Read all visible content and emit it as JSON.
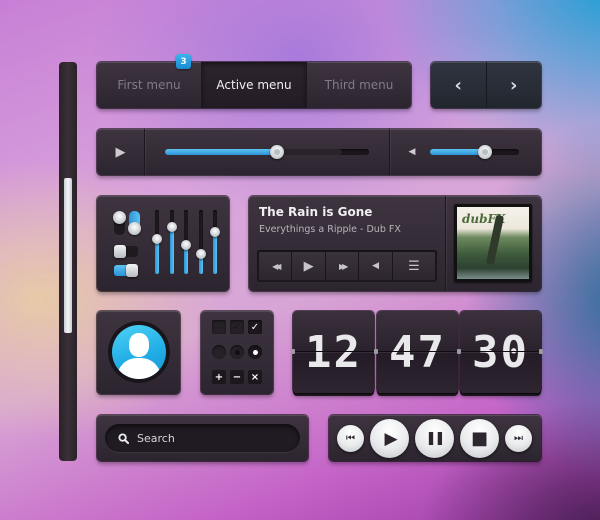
{
  "colors": {
    "accent": "#2a94d6",
    "panel": "#342b36",
    "badge": "#1a8bd1"
  },
  "scrollbar": {
    "thumb_start_fraction": 0.29,
    "thumb_end_fraction": 0.68
  },
  "menu": {
    "items": [
      {
        "label": "First menu",
        "badge": "3",
        "active": false
      },
      {
        "label": "Active menu",
        "active": true
      },
      {
        "label": "Third menu",
        "active": false
      }
    ]
  },
  "nav_arrows": {
    "prev_icon": "chevron-left-icon",
    "prev_glyph": "‹",
    "next_icon": "chevron-right-icon",
    "next_glyph": "›"
  },
  "progress_bar": {
    "play_glyph": "▶",
    "progress_fraction": 0.55,
    "buffered_fraction": 0.87,
    "volume_glyph": "◀",
    "volume_fraction": 0.62
  },
  "equalizer": {
    "vertical_toggle": {
      "left_on": false,
      "right_on": true
    },
    "horizontal_toggles": [
      {
        "on": false
      },
      {
        "on": true
      }
    ],
    "sliders": [
      0.55,
      0.74,
      0.45,
      0.32,
      0.65
    ]
  },
  "player": {
    "title": "The Rain is Gone",
    "subtitle": "Everythings a Ripple - Dub FX",
    "controls": [
      {
        "name": "rewind",
        "glyph": "◀◀"
      },
      {
        "name": "play",
        "glyph": "▶"
      },
      {
        "name": "fast-forward",
        "glyph": "▶▶"
      },
      {
        "name": "volume",
        "glyph": "◀"
      },
      {
        "name": "playlist",
        "glyph": "☰"
      }
    ],
    "album_logo": "dubFX"
  },
  "form_controls": {
    "checkboxes": [
      {
        "state": "unchecked"
      },
      {
        "state": "checked-dim",
        "glyph": "✓"
      },
      {
        "state": "checked",
        "glyph": "✓"
      }
    ],
    "radios": [
      {
        "state": "unselected"
      },
      {
        "state": "selected-dim"
      },
      {
        "state": "selected"
      }
    ],
    "actions": [
      {
        "name": "add",
        "glyph": "+"
      },
      {
        "name": "remove",
        "glyph": "−"
      },
      {
        "name": "close",
        "glyph": "×"
      }
    ]
  },
  "clock": {
    "hours": "12",
    "minutes": "47",
    "seconds": "30"
  },
  "search": {
    "placeholder": "Search",
    "value": ""
  },
  "transport": {
    "buttons": [
      {
        "name": "skip-back",
        "glyph": "⏮"
      },
      {
        "name": "play",
        "glyph": "▶"
      },
      {
        "name": "pause",
        "glyph": "❚❚"
      },
      {
        "name": "stop",
        "glyph": "■"
      },
      {
        "name": "skip-forward",
        "glyph": "⏭"
      }
    ]
  }
}
